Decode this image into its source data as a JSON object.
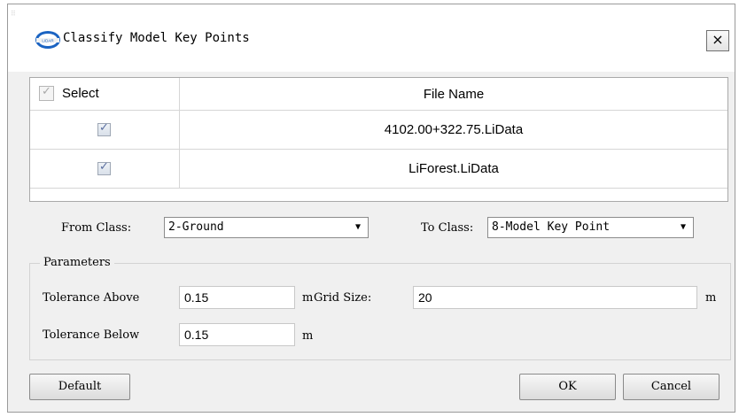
{
  "window": {
    "title": "Classify Model Key Points",
    "close_label": "×",
    "app_icon": "lidar-logo-icon"
  },
  "table": {
    "headers": {
      "select": "Select",
      "file_name": "File Name"
    },
    "rows": [
      {
        "selected": true,
        "file_name": "4102.00+322.75.LiData"
      },
      {
        "selected": true,
        "file_name": "LiForest.LiData"
      }
    ]
  },
  "classes": {
    "from_label": "From Class:",
    "from_value": "2-Ground",
    "to_label": "To Class:",
    "to_value": "8-Model Key Point"
  },
  "parameters": {
    "group_title": "Parameters",
    "tolerance_above_label": "Tolerance Above",
    "tolerance_above_value": "0.15",
    "tolerance_above_unit": "m",
    "grid_size_label": "Grid Size:",
    "grid_size_value": "20",
    "grid_size_unit": "m",
    "tolerance_below_label": "Tolerance Below",
    "tolerance_below_value": "0.15",
    "tolerance_below_unit": "m"
  },
  "buttons": {
    "default": "Default",
    "ok": "OK",
    "cancel": "Cancel"
  }
}
